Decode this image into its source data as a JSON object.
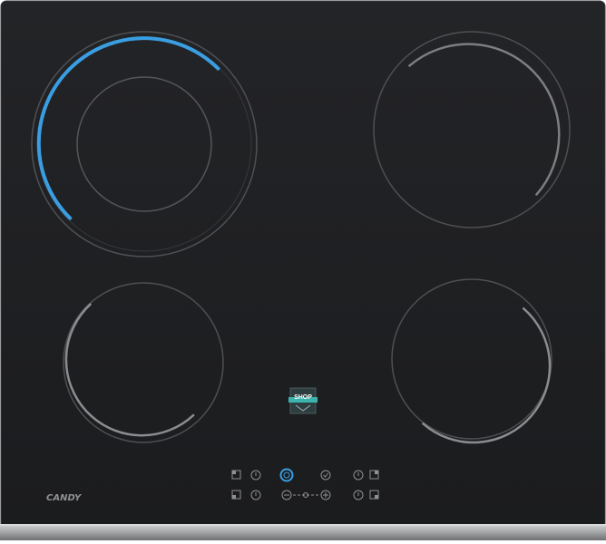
{
  "brand": {
    "logo_text": "CANDY",
    "badge_text": "SHOP"
  },
  "colors": {
    "glass": "#1e1f21",
    "zone_line": "#58595c",
    "active_arc": "#3a9ee2",
    "frame_top": "#b4b6b8",
    "frame_bottom": "#6e7072",
    "badge_bg": "#2e3d3f",
    "badge_accent": "#3cb3ad",
    "control_icon": "#8e9092",
    "power_button_ring": "#3a9ee2"
  },
  "zones": [
    {
      "name": "front-left-large-zone",
      "active": true
    },
    {
      "name": "rear-right-zone",
      "active": false
    },
    {
      "name": "rear-left-zone",
      "active": false
    },
    {
      "name": "front-right-zone",
      "active": false
    }
  ],
  "controls": {
    "power_button": {
      "icon": "power-icon"
    },
    "top_row": [
      "zone-select-icon",
      "timer-icon",
      "power-icon",
      "lock-icon",
      "timer-icon",
      "zone-select-icon"
    ],
    "bottom_row": [
      "zone-select-icon",
      "timer-icon",
      "minus-icon",
      "slider-track",
      "plus-icon",
      "timer-icon",
      "zone-select-icon"
    ]
  }
}
